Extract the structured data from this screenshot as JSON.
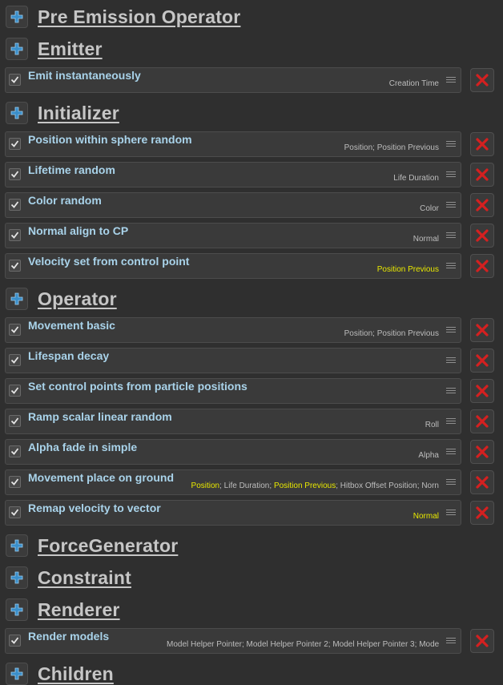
{
  "sections": [
    {
      "title": "Pre Emission Operator",
      "items": []
    },
    {
      "title": "Emitter",
      "items": [
        {
          "name": "Emit instantaneously",
          "checked": true,
          "fields": [
            {
              "t": "Creation Time",
              "hl": false
            }
          ]
        }
      ]
    },
    {
      "title": "Initializer",
      "items": [
        {
          "name": "Position within sphere random",
          "checked": true,
          "fields": [
            {
              "t": "Position",
              "hl": false
            },
            {
              "t": "Position Previous",
              "hl": false
            }
          ]
        },
        {
          "name": "Lifetime random",
          "checked": true,
          "fields": [
            {
              "t": "Life Duration",
              "hl": false
            }
          ]
        },
        {
          "name": "Color random",
          "checked": true,
          "fields": [
            {
              "t": "Color",
              "hl": false
            }
          ]
        },
        {
          "name": "Normal align to CP",
          "checked": true,
          "fields": [
            {
              "t": "Normal",
              "hl": false
            }
          ]
        },
        {
          "name": "Velocity set from control point",
          "checked": true,
          "fields": [
            {
              "t": "Position Previous",
              "hl": true
            }
          ]
        }
      ]
    },
    {
      "title": "Operator",
      "items": [
        {
          "name": "Movement basic",
          "checked": true,
          "fields": [
            {
              "t": "Position",
              "hl": false
            },
            {
              "t": "Position Previous",
              "hl": false
            }
          ]
        },
        {
          "name": "Lifespan decay",
          "checked": true,
          "fields": []
        },
        {
          "name": "Set control points from particle positions",
          "checked": true,
          "fields": []
        },
        {
          "name": "Ramp scalar linear random",
          "checked": true,
          "fields": [
            {
              "t": "Roll",
              "hl": false
            }
          ]
        },
        {
          "name": "Alpha fade in simple",
          "checked": true,
          "fields": [
            {
              "t": "Alpha",
              "hl": false
            }
          ]
        },
        {
          "name": "Movement place on ground",
          "checked": true,
          "fields": [
            {
              "t": "Position",
              "hl": true
            },
            {
              "t": "Life Duration",
              "hl": false
            },
            {
              "t": "Position Previous",
              "hl": true
            },
            {
              "t": "Hitbox Offset Position",
              "hl": false
            },
            {
              "t": "Norn",
              "hl": false
            }
          ]
        },
        {
          "name": "Remap velocity to vector",
          "checked": true,
          "fields": [
            {
              "t": "Normal",
              "hl": true
            }
          ]
        }
      ]
    },
    {
      "title": "ForceGenerator",
      "items": []
    },
    {
      "title": "Constraint",
      "items": []
    },
    {
      "title": "Renderer",
      "items": [
        {
          "name": "Render models",
          "checked": true,
          "fields": [
            {
              "t": "Model Helper Pointer",
              "hl": false
            },
            {
              "t": "Model Helper Pointer 2",
              "hl": false
            },
            {
              "t": "Model Helper Pointer 3",
              "hl": false
            },
            {
              "t": "Model Helper Poin",
              "hl": false
            }
          ]
        }
      ]
    },
    {
      "title": "Children",
      "items": []
    }
  ],
  "field_separator": "; ",
  "colors": {
    "background": "#2f2f2f",
    "section_title": "#c6c6c6",
    "operator_name": "#a9d3ea",
    "field_text": "#bdbdbd",
    "field_highlight": "#e8e800",
    "add_icon": "#3a8ec9",
    "delete_icon": "#d42020"
  },
  "icons": {
    "add": "plus-icon",
    "delete": "x-icon",
    "check": "checkmark-icon",
    "handle": "drag-handle-icon"
  }
}
